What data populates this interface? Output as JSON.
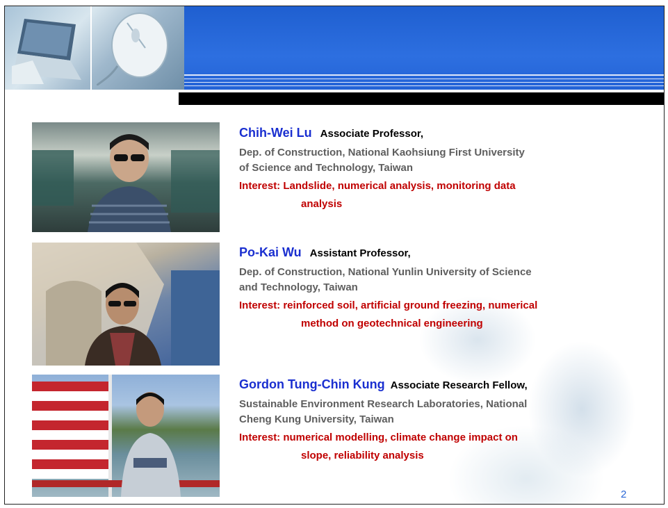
{
  "people": [
    {
      "name": "Chih-Wei Lu",
      "title": "Associate Professor,",
      "dept_line1": "Dep. of Construction, National Kaohsiung First University",
      "dept_line2": "of Science and Technology, Taiwan",
      "interest_line1": "Interest: Landslide, numerical analysis, monitoring data",
      "interest_line2": "analysis"
    },
    {
      "name": "Po-Kai Wu",
      "title": "Assistant Professor,",
      "dept_line1": "Dep. of Construction, National Yunlin University of Science",
      "dept_line2": "and Technology, Taiwan",
      "interest_line1": "Interest: reinforced soil, artificial ground freezing, numerical",
      "interest_line2": "method on geotechnical engineering"
    },
    {
      "name": "Gordon Tung-Chin Kung",
      "title": "Associate Research Fellow,",
      "dept_line1": "Sustainable Environment Research Laboratories, National",
      "dept_line2": "Cheng Kung University, Taiwan",
      "interest_line1": "Interest: numerical modelling, climate change impact on",
      "interest_line2": "slope,  reliability analysis"
    }
  ],
  "page_number": "2",
  "colors": {
    "banner_blue": "#2463d6",
    "name_blue": "#1a2fd0",
    "interest_red": "#c00000",
    "dept_gray": "#5e5e5e"
  },
  "icons": [
    "laptop-icon",
    "computer-mouse-icon"
  ]
}
